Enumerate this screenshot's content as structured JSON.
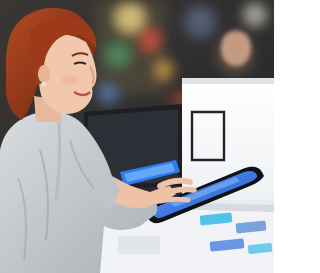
{
  "image": {
    "subject": "woman-using-tablet-in-electronics-store",
    "palette": {
      "background_dark": "#2a2c30",
      "bokeh_red": "#e0523b",
      "bokeh_green": "#4fa06a",
      "bokeh_blue": "#5b8fd6",
      "hair": "#8a3418",
      "skin": "#f1c7ad",
      "shirt": "#c9cdd0",
      "counter_white": "#f3f4f6",
      "screen_blue": "#2f6fe0",
      "accent_cyan": "#37b9e6"
    }
  }
}
